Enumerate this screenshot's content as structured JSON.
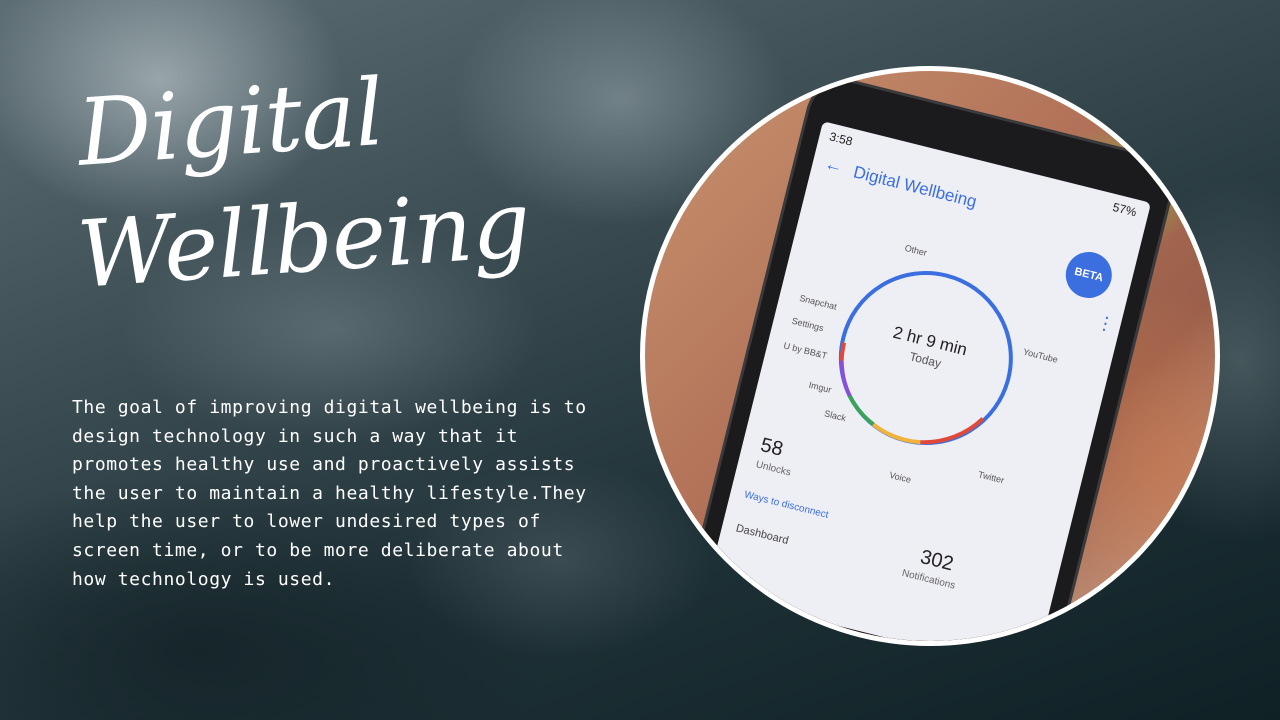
{
  "slide": {
    "title_line1": "Digital",
    "title_line2": "Wellbeing",
    "body": "The goal of improving digital wellbeing is to design technology in such a way that it promotes healthy use and proactively assists the user to maintain a healthy lifestyle.They help the user to lower undesired types of screen time, or to be more deliberate about how technology is used."
  },
  "phone": {
    "status_time": "3:58",
    "battery": "57%",
    "app_title": "Digital Wellbeing",
    "beta_badge": "BETA",
    "total_time": "2 hr 9 min",
    "today_label": "Today",
    "segments": [
      "Other",
      "YouTube",
      "Twitter",
      "Voice",
      "Slack",
      "Imgur",
      "U by BB&T",
      "Settings",
      "Snapchat"
    ],
    "unlocks_value": "58",
    "unlocks_label": "Unlocks",
    "notifications_value": "302",
    "notifications_label": "Notifications",
    "disconnect_link": "Ways to disconnect",
    "dashboard_label": "Dashboard"
  },
  "colors": {
    "accent_blue": "#3b6fe0",
    "ring_red": "#e0483a",
    "ring_yellow": "#f2b33a",
    "ring_green": "#3aa35a",
    "ring_purple": "#8a4fd8"
  }
}
